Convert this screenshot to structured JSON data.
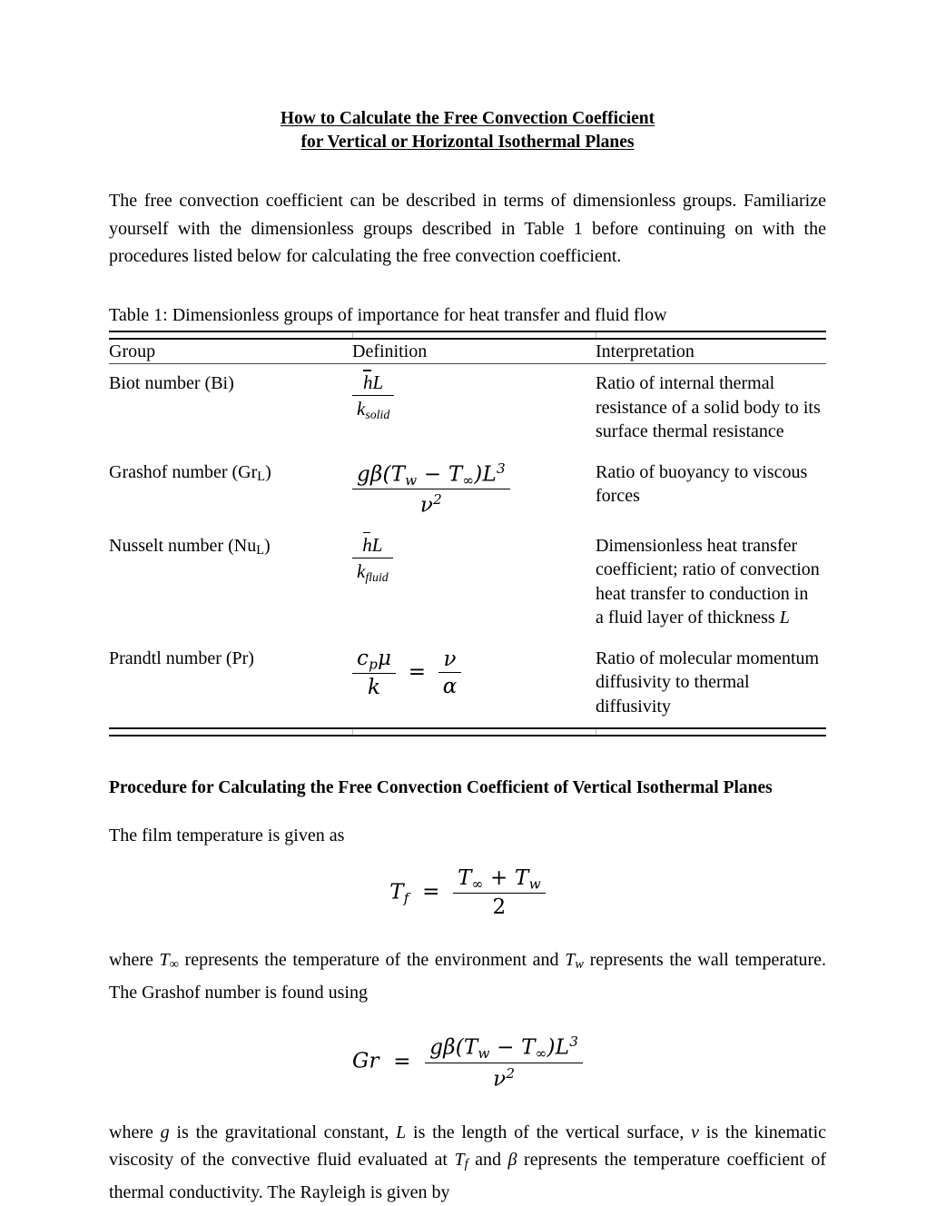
{
  "document": {
    "title_line_1": "How to Calculate the Free Convection Coefficient",
    "title_line_2": "for Vertical or Horizontal Isothermal Planes",
    "intro_paragraph": "The free convection coefficient can be described in terms of dimensionless groups.  Familiarize yourself with the dimensionless groups described in Table 1 before continuing on with the procedures listed below for calculating the free convection coefficient."
  },
  "table": {
    "caption": "Table 1: Dimensionless groups of importance for heat transfer and fluid flow",
    "headers": {
      "group": "Group",
      "definition": "Definition",
      "interpretation": "Interpretation"
    },
    "rows": [
      {
        "group_name": "Biot number (Bi)",
        "group_prefix": "Biot number (Bi)",
        "group_subscript": "",
        "definition_numerator": "hL",
        "definition_denominator": "ksolid",
        "interpretation_lines": [
          "Ratio of internal thermal",
          "resistance of a solid body to its",
          "surface thermal resistance"
        ]
      },
      {
        "group_name": "Grashof number (GrL)",
        "group_prefix": "Grashof number (Gr",
        "group_subscript": "L",
        "group_suffix": ")",
        "definition_numerator": "gβ(Tw − T∞)L3",
        "definition_denominator": "ν2",
        "interpretation_lines": [
          "Ratio of buoyancy to viscous",
          "forces"
        ]
      },
      {
        "group_name": "Nusselt number (NuL)",
        "group_prefix": "Nusselt number (Nu",
        "group_subscript": "L",
        "group_suffix": ")",
        "definition_numerator": "hL",
        "definition_denominator": "kfluid",
        "interpretation_lines": [
          "Dimensionless heat transfer",
          "coefficient; ratio of convection",
          "heat transfer to conduction in",
          "a fluid layer of thickness L"
        ]
      },
      {
        "group_name": "Prandtl number (Pr)",
        "group_prefix": "Prandtl number (Pr)",
        "group_subscript": "",
        "definition_numerator": "cpμ",
        "definition_denominator": "k",
        "definition_equals": "=",
        "definition_numerator_2": "ν",
        "definition_denominator_2": "α",
        "interpretation_lines": [
          "Ratio of molecular momentum",
          "diffusivity to thermal",
          "diffusivity"
        ]
      }
    ]
  },
  "procedure": {
    "heading": "Procedure for Calculating the Free Convection Coefficient of Vertical Isothermal Planes",
    "film_temp_lead": "The film temperature is given as",
    "film_temp_equation": {
      "lhs_var": "T",
      "lhs_sub": "f",
      "equals": "=",
      "numerator": "T∞ + Tw",
      "denominator": "2"
    },
    "after_film_paragraph_part_1": "where ",
    "after_film_paragraph_part_2": " represents the temperature of the environment and ",
    "after_film_paragraph_part_3": " represents the wall temperature. The Grashof number is found using",
    "grashof_equation": {
      "lhs": "Gr",
      "equals": "=",
      "numerator": "gβ(Tw − T∞)L3",
      "denominator": "ν2"
    },
    "closing_paragraph_segments": {
      "s1": "where ",
      "v1": "g",
      "s2": " is the gravitational constant, ",
      "v2": "L",
      "s3": " is the length of the vertical surface, ",
      "v3": "ν",
      "s4": " is the kinematic viscosity of the convective fluid evaluated at ",
      "v4": "T",
      "v4sub": "f",
      "s5": " and ",
      "v5": "β",
      "s6": " represents the temperature coefficient of thermal conductivity.  The Rayleigh is given by"
    }
  },
  "colors": {
    "text": "#000000",
    "background": "#ffffff",
    "rule": "#111111"
  }
}
